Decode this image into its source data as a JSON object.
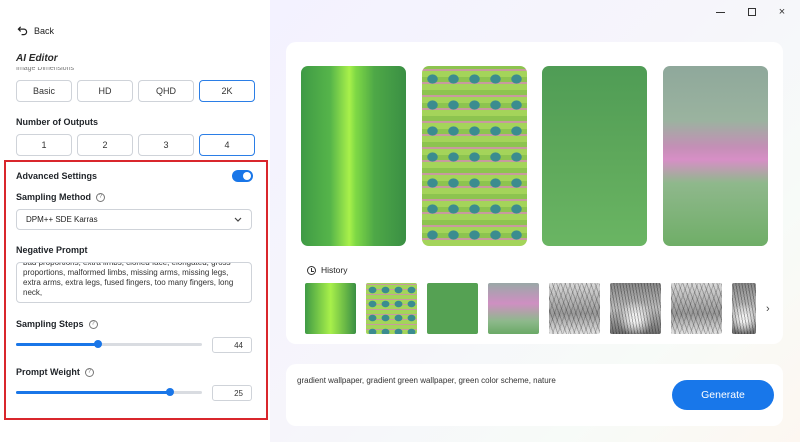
{
  "window": {
    "minimize": "",
    "maximize": "",
    "close": "×"
  },
  "nav": {
    "back_label": "Back",
    "title": "AI Editor",
    "cutoff_label": "Image Dimensions"
  },
  "resolution": {
    "options": [
      "Basic",
      "HD",
      "QHD",
      "2K"
    ],
    "selected": "2K"
  },
  "outputs": {
    "label": "Number of Outputs",
    "options": [
      "1",
      "2",
      "3",
      "4"
    ],
    "selected": "4"
  },
  "advanced": {
    "label": "Advanced Settings",
    "enabled": true,
    "sampling_method": {
      "label": "Sampling Method",
      "value": "DPM++ SDE Karras"
    },
    "negative_prompt": {
      "label": "Negative Prompt",
      "value": "bad proportions, extra limbs, cloned face, elongated, gross proportions, malformed limbs, missing arms, missing legs, extra arms, extra legs, fused fingers, too many fingers, long neck,"
    },
    "sampling_steps": {
      "label": "Sampling Steps",
      "value": "44",
      "fraction": 0.44
    },
    "prompt_weight": {
      "label": "Prompt Weight",
      "value": "25",
      "fraction": 0.83
    }
  },
  "history": {
    "label": "History"
  },
  "prompt": {
    "value": "gradient wallpaper, gradient green wallpaper, green color scheme, nature",
    "generate_label": "Generate"
  },
  "colors": {
    "accent": "#1877ea",
    "highlight_border": "#d9262c"
  }
}
